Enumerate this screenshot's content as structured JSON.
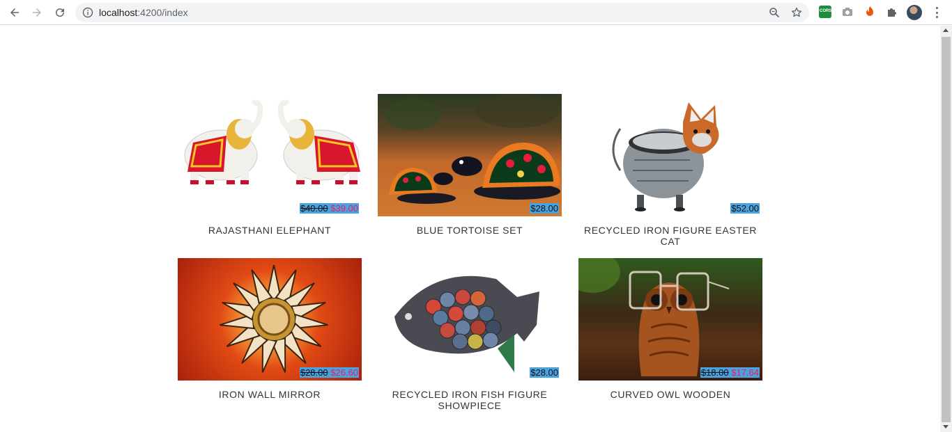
{
  "browser": {
    "url_host": "localhost",
    "url_path": ":4200/index",
    "extensions": [
      {
        "name": "cors-extension-icon",
        "color": "#1e8e3e",
        "label": "CORS"
      },
      {
        "name": "camera-extension-icon",
        "color": "#9aa0a6",
        "label": ""
      },
      {
        "name": "orange-extension-icon",
        "color": "#e8590c",
        "label": ""
      },
      {
        "name": "puzzle-extensions-icon",
        "color": "#5f6368",
        "label": ""
      }
    ]
  },
  "products": [
    {
      "title": "RAJASTHANI ELEPHANT",
      "price_old": "$40.00",
      "price_new": "$39.00",
      "image": "elephant-pair"
    },
    {
      "title": "BLUE TORTOISE SET",
      "price": "$28.00",
      "image": "tortoise-set"
    },
    {
      "title": "RECYCLED IRON FIGURE EASTER CAT",
      "price": "$52.00",
      "image": "iron-cat"
    },
    {
      "title": "IRON WALL MIRROR",
      "price_old": "$28.00",
      "price_new": "$26.60",
      "image": "sunflower-mirror"
    },
    {
      "title": "RECYCLED IRON FISH FIGURE SHOWPIECE",
      "price": "$28.00",
      "image": "iron-fish"
    },
    {
      "title": "CURVED OWL WOODEN",
      "price_old": "$18.00",
      "price_new": "$17.64",
      "image": "owl-spectacle-holder"
    }
  ],
  "colors": {
    "price_bg": "#4aa3df",
    "price_new": "#e91e63",
    "title": "#333333"
  }
}
